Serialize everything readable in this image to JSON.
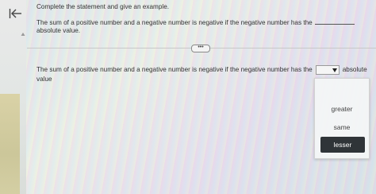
{
  "instruction": "Complete the statement and give an example.",
  "question": {
    "text": "The sum of a positive number and a negative number is negative if the negative number has the",
    "continuation": "absolute value."
  },
  "expand_label": "•••",
  "answer": {
    "text_before": "The sum of a positive number and a negative number is negative if the negative number has the",
    "text_after": "absolute",
    "text_wrap": "value",
    "selected_value": ""
  },
  "dropdown": {
    "options": [
      "greater",
      "same",
      "lesser"
    ],
    "highlighted": "lesser"
  },
  "colors": {
    "highlight_bg": "#2f3438",
    "highlight_text": "#ffffff"
  },
  "icons": {
    "back": "back-arrow-bar-icon",
    "caret": "caret-down-icon",
    "scroll_up": "scroll-up-icon"
  }
}
